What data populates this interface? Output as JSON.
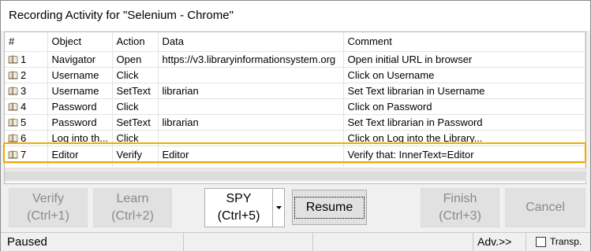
{
  "window": {
    "title": "Recording Activity for \"Selenium - Chrome\""
  },
  "grid": {
    "columns": [
      "#",
      "Object",
      "Action",
      "Data",
      "Comment"
    ],
    "rows": [
      {
        "num": "1",
        "object": "Navigator",
        "action": "Open",
        "data": "https://v3.libraryinformationsystem.org",
        "comment": "Open initial URL in browser"
      },
      {
        "num": "2",
        "object": "Username",
        "action": "Click",
        "data": "",
        "comment": "Click on Username"
      },
      {
        "num": "3",
        "object": "Username",
        "action": "SetText",
        "data": "librarian",
        "comment": "Set Text librarian in Username"
      },
      {
        "num": "4",
        "object": "Password",
        "action": "Click",
        "data": "",
        "comment": "Click on Password"
      },
      {
        "num": "5",
        "object": "Password",
        "action": "SetText",
        "data": "librarian",
        "comment": "Set Text librarian in Password"
      },
      {
        "num": "6",
        "object": "Log into th...",
        "action": "Click",
        "data": "",
        "comment": "Click on Log into the Library..."
      },
      {
        "num": "7",
        "object": "Editor",
        "action": "Verify",
        "data": "Editor",
        "comment": "Verify that: InnerText=Editor"
      }
    ],
    "selected_row": 7
  },
  "buttons": {
    "verify": {
      "line1": "Verify",
      "line2": "(Ctrl+1)"
    },
    "learn": {
      "line1": "Learn",
      "line2": "(Ctrl+2)"
    },
    "spy": {
      "line1": "SPY",
      "line2": "(Ctrl+5)"
    },
    "resume": {
      "label": "Resume"
    },
    "finish": {
      "line1": "Finish",
      "line2": "(Ctrl+3)"
    },
    "cancel": {
      "label": "Cancel"
    }
  },
  "status": {
    "text": "Paused",
    "advanced_label": "Adv.>>",
    "transparent_label": "Transp.",
    "transparent_checked": false
  },
  "colors": {
    "highlight": "#f3a800"
  },
  "icons": {
    "row_icon": "book-icon",
    "dropdown": "dropdown-arrow-icon"
  }
}
